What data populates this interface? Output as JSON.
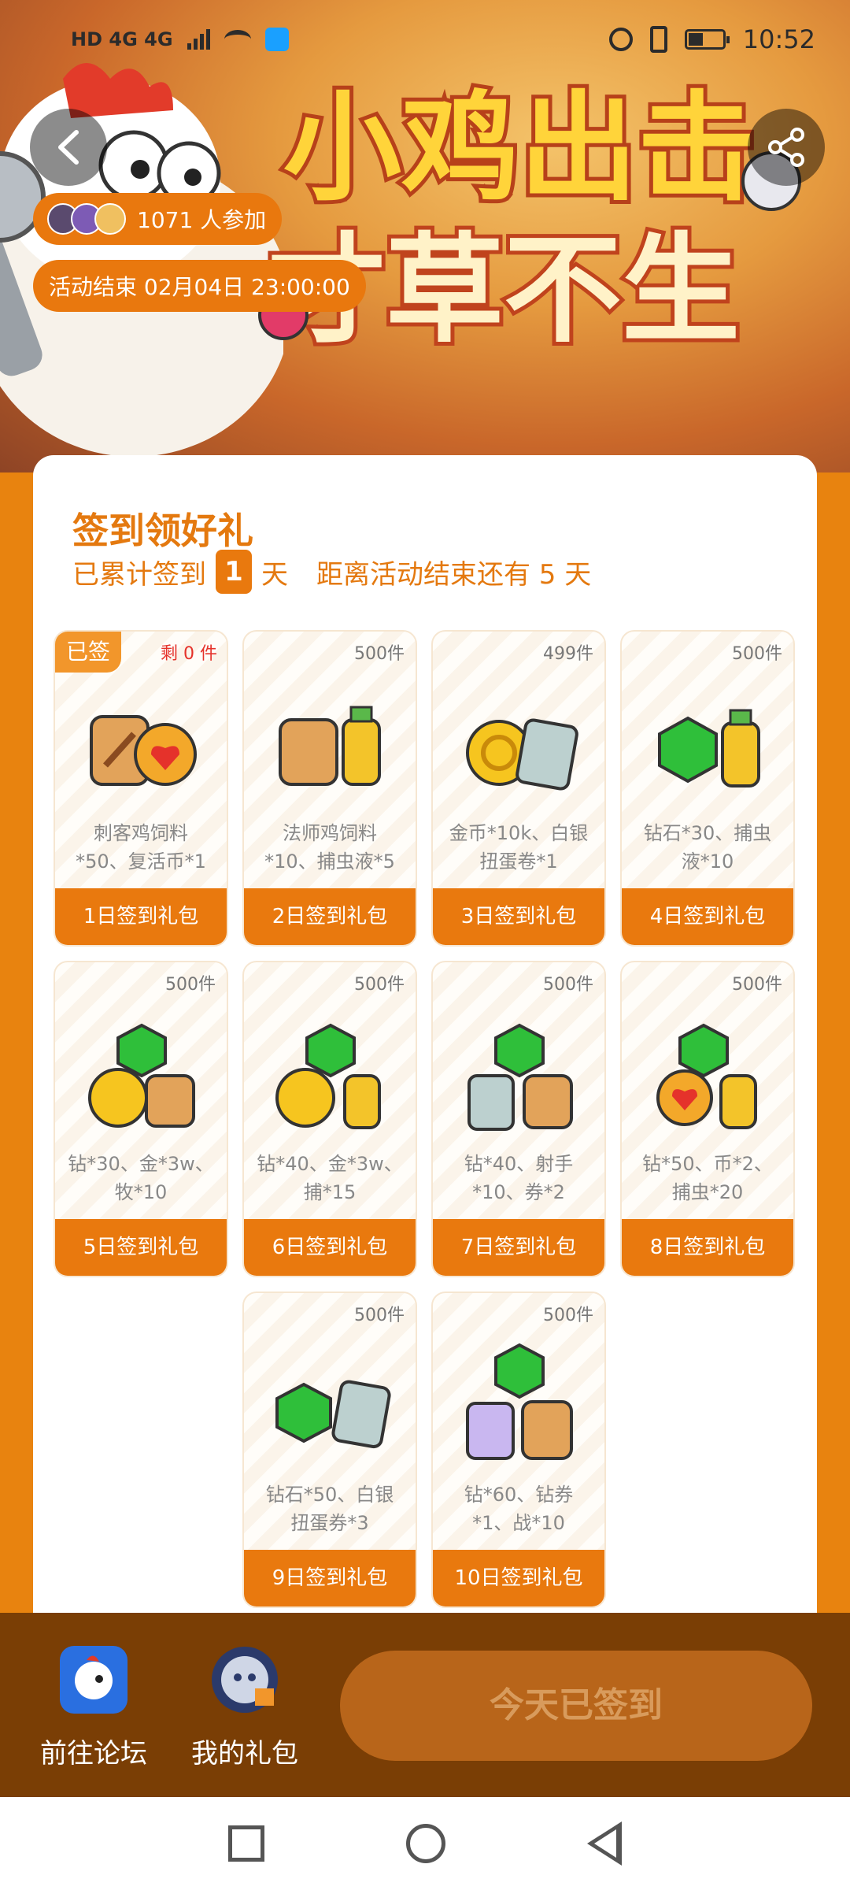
{
  "status_bar": {
    "left_text": "HD 4G 4G",
    "time": "10:52"
  },
  "banner": {
    "title_line1": "小鸡出击",
    "title_line2": "寸草不生",
    "participants": "1071 人参加",
    "end_time": "活动结束 02月04日 23:00:00"
  },
  "icons": {
    "back": "back-arrow-icon",
    "share": "share-icon"
  },
  "signin": {
    "title": "签到领好礼",
    "cumulative_prefix": "已累计签到",
    "cumulative_days": "1",
    "days_unit": "天",
    "remaining_text": "距离活动结束还有 5 天"
  },
  "gifts": [
    {
      "signed": "已签",
      "count": "剩 0 件",
      "desc_line1": "刺客鸡饲料",
      "desc_line2": "*50、复活币*1",
      "button": "1日签到礼包"
    },
    {
      "count": "500件",
      "desc_line1": "法师鸡饲料",
      "desc_line2": "*10、捕虫液*5",
      "button": "2日签到礼包"
    },
    {
      "count": "499件",
      "desc_line1": "金币*10k、白银",
      "desc_line2": "扭蛋卷*1",
      "button": "3日签到礼包"
    },
    {
      "count": "500件",
      "desc_line1": "钻石*30、捕虫",
      "desc_line2": "液*10",
      "button": "4日签到礼包"
    },
    {
      "count": "500件",
      "desc_line1": "钻*30、金*3w、",
      "desc_line2": "牧*10",
      "button": "5日签到礼包"
    },
    {
      "count": "500件",
      "desc_line1": "钻*40、金*3w、",
      "desc_line2": "捕*15",
      "button": "6日签到礼包"
    },
    {
      "count": "500件",
      "desc_line1": "钻*40、射手",
      "desc_line2": "*10、券*2",
      "button": "7日签到礼包"
    },
    {
      "count": "500件",
      "desc_line1": "钻*50、币*2、",
      "desc_line2": "捕虫*20",
      "button": "8日签到礼包"
    },
    {
      "count": "500件",
      "desc_line1": "钻石*50、白银",
      "desc_line2": "扭蛋券*3",
      "button": "9日签到礼包"
    },
    {
      "count": "500件",
      "desc_line1": "钻*60、钻券",
      "desc_line2": "*1、战*10",
      "button": "10日签到礼包"
    }
  ],
  "footer": {
    "forum_label": "前往论坛",
    "my_gifts_label": "我的礼包",
    "signin_button": "今天已签到"
  },
  "colors": {
    "brand_orange": "#e9790e",
    "footer_brown": "#7a3e05",
    "accent_red": "#e5322b"
  }
}
